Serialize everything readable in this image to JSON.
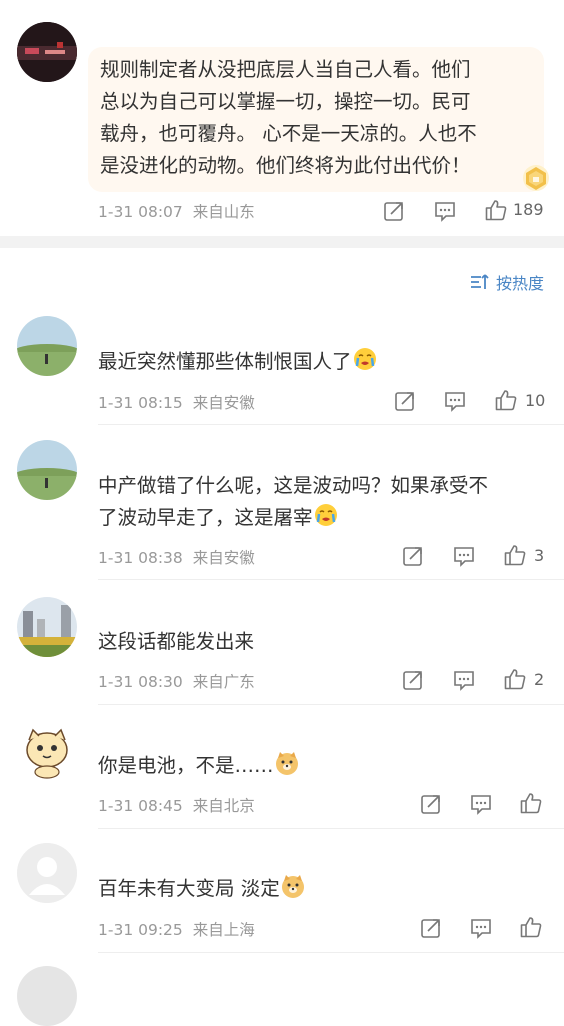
{
  "hot_comment": {
    "lines": [
      "规则制定者从没把底层人当自己人看。他们",
      "总以为自己可以掌握一切，操控一切。民可",
      "载舟，也可覆舟。 心不是一天凉的。人也不",
      "是没进化的动物。他们终将为此付出代价！"
    ],
    "time": "1-31 08:07",
    "location": "来自山东",
    "likes": "189"
  },
  "sort_label": "按热度",
  "comments": [
    {
      "text": "最近突然懂那些体制恨国人了",
      "time": "1-31 08:15",
      "location": "来自安徽",
      "likes": "10"
    },
    {
      "lines": [
        "中产做错了什么呢，这是波动吗？如果承受不",
        "了波动早走了，这是屠宰"
      ],
      "time": "1-31 08:38",
      "location": "来自安徽",
      "likes": "3"
    },
    {
      "text": "这段话都能发出来",
      "time": "1-31 08:30",
      "location": "来自广东",
      "likes": "2"
    },
    {
      "text": "你是电池，不是……",
      "time": "1-31 08:45",
      "location": "来自北京",
      "likes": ""
    },
    {
      "text": "百年未有大变局 淡定",
      "time": "1-31 09:25",
      "location": "来自上海",
      "likes": ""
    }
  ],
  "colors": {
    "accent": "#4a86c5",
    "meta": "#999999",
    "bubble": "#fff8f0"
  }
}
